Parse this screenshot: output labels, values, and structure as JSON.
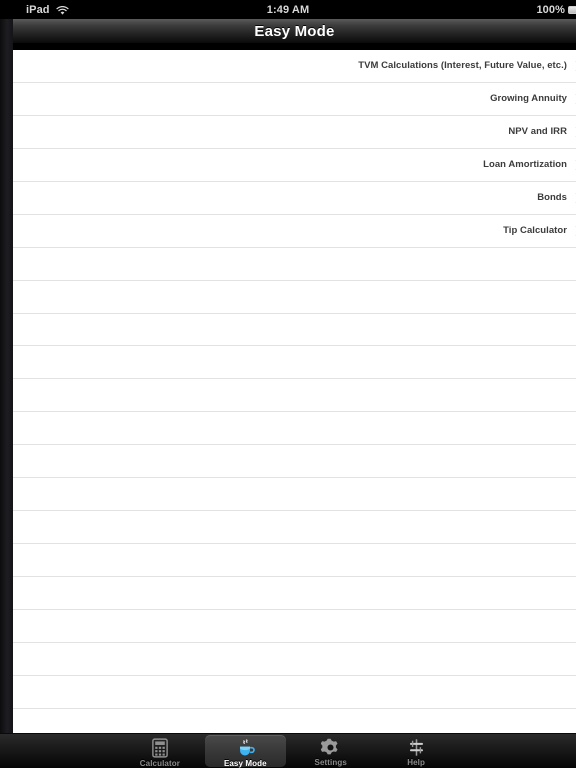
{
  "status_bar": {
    "device": "iPad",
    "wifi_icon": "wifi-icon",
    "time": "1:49 AM",
    "battery_percent": "100%",
    "battery_icon": "battery-full-icon"
  },
  "nav_bar": {
    "title": "Easy Mode"
  },
  "list": {
    "items": [
      {
        "label": "TVM Calculations (Interest, Future Value, etc.)",
        "accessory": "chevron-right-icon"
      },
      {
        "label": "Growing Annuity",
        "accessory": "chevron-right-icon"
      },
      {
        "label": "NPV and IRR",
        "accessory": "chevron-right-icon"
      },
      {
        "label": "Loan Amortization",
        "accessory": "chevron-right-icon"
      },
      {
        "label": "Bonds",
        "accessory": "chevron-right-icon"
      },
      {
        "label": "Tip Calculator",
        "accessory": "chevron-right-icon"
      }
    ],
    "empty_row_count": 14
  },
  "tab_bar": {
    "selected": "Easy Mode",
    "tabs": [
      {
        "label": "Calculator",
        "icon": "calculator-icon",
        "selected": false
      },
      {
        "label": "Easy Mode",
        "icon": "coffee-cup-icon",
        "selected": true
      },
      {
        "label": "Settings",
        "icon": "gear-icon",
        "selected": false
      },
      {
        "label": "Help",
        "icon": "sliders-icon",
        "selected": false
      }
    ]
  },
  "colors": {
    "accent": "#35a8e0",
    "list_background": "#ffffff",
    "separator": "#e2e2e2",
    "row_text": "#3b3b3b",
    "chrome": "#1d1d1d",
    "tab_label_inactive": "#8c8c8c",
    "tab_label_active": "#ffffff"
  }
}
